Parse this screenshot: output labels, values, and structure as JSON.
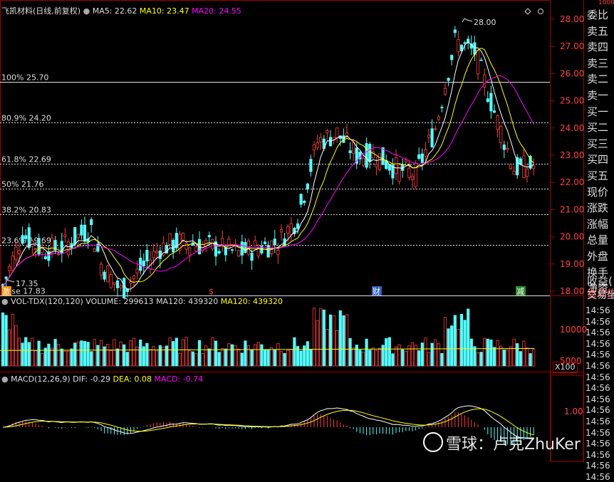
{
  "main": {
    "title": "飞凯材料(日线,前复权)",
    "ma5_label": "MA5: 22.62",
    "ma10_label": "MA10: 23.47",
    "ma20_label": "MA20: 24.55",
    "high_label": "28.00",
    "low_label": "17.35",
    "fib_levels": [
      {
        "label": "100% 25.70",
        "price": 25.7
      },
      {
        "label": "80.9% 24.20",
        "price": 24.2
      },
      {
        "label": "61.8% 22.69",
        "price": 22.69
      },
      {
        "label": "50% 21.76",
        "price": 21.76
      },
      {
        "label": "38.2% 20.83",
        "price": 20.83
      },
      {
        "label": "23.6% 19.69",
        "price": 19.69
      },
      {
        "label": "Base 17.83",
        "price": 17.83
      }
    ],
    "price_axis": [
      "28.00",
      "27.00",
      "26.00",
      "25.00",
      "24.00",
      "23.00",
      "22.00",
      "21.00",
      "20.00",
      "19.00",
      "18.00"
    ],
    "events": [
      "激",
      "$",
      "财",
      "减"
    ]
  },
  "volume": {
    "title": "VOL-TDX(120,120)",
    "volume_label": "VOLUME: 299613",
    "ma120a_label": "MA120: 439320",
    "ma120b_label": "MA120: 439320",
    "axis": [
      "10000",
      "5000"
    ],
    "unit": "X100"
  },
  "macd": {
    "title": "MACD(12,26,9)",
    "dif_label": "DIF: -0.29",
    "dea_label": "DEA: 0.08",
    "macd_label": "MACD: -0.74",
    "axis": [
      "1.00"
    ]
  },
  "sidebar": {
    "top_value": "1000",
    "items": [
      "委比",
      "卖五",
      "卖四",
      "卖三",
      "卖二",
      "卖一",
      "买一",
      "买二",
      "买三",
      "买四",
      "买五",
      "现价",
      "涨跌",
      "涨幅",
      "总量",
      "外盘",
      "换手",
      "净资",
      "收益(",
      "自动约",
      "交易坐"
    ],
    "times": [
      "14:56",
      "14:56",
      "14:56",
      "14:56",
      "14:56",
      "14:56",
      "14:56",
      "14:56",
      "14:56",
      "14:56",
      "14:56",
      "14:56",
      "14:56",
      "14:56",
      "14:56",
      "14:56"
    ]
  },
  "watermark": "雪球：卢克ZhuKer",
  "colors": {
    "up": "#ff3c3c",
    "down": "#54fcfc",
    "ma5": "#ffffff",
    "ma10": "#ffff00",
    "ma20": "#ff00ff"
  }
}
